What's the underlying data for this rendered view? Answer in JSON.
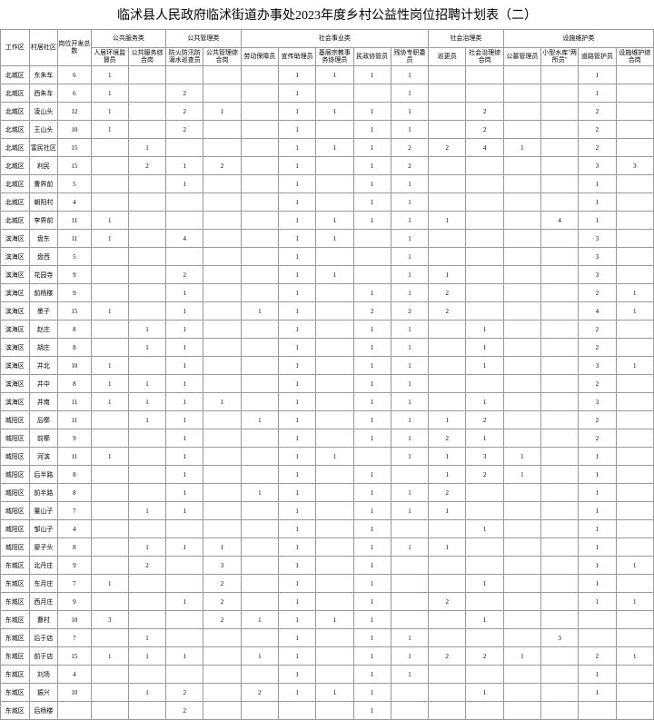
{
  "title": "临沭县人民政府临沭街道办事处2023年度乡村公益性岗位招聘计划表（二）",
  "headers": {
    "area": "工作区",
    "village": "村居社区",
    "total": "岗位开发总数",
    "g1": "公共服务类",
    "g2": "公共管理类",
    "g3": "社会事业类",
    "g4": "社会治理类",
    "g5": "设施维护类",
    "c1": "人居环境监督员",
    "c2": "公共服务综合岗",
    "c3": "防火防汛防溺水巡查员",
    "c4": "公共管理综合岗",
    "c5": "劳动保障员",
    "c6": "宣传助理员",
    "c7": "基层宗教事务协理员",
    "c8": "民政协管员",
    "c9": "残协专职委员",
    "c10": "巡更员",
    "c11": "社会治理综合岗",
    "c12": "公墓管理员",
    "c13": "小型水库\"两所员\"",
    "c14": "道路管护员",
    "c15": "设施维护综合岗"
  },
  "rows": [
    {
      "a": "北城区",
      "v": "东朱车",
      "t": "6",
      "d": [
        "1",
        "",
        "",
        "",
        "",
        "1",
        "1",
        "1",
        "1",
        "",
        "",
        "",
        "",
        "1",
        ""
      ]
    },
    {
      "a": "北城区",
      "v": "西朱车",
      "t": "6",
      "d": [
        "1",
        "",
        "2",
        "",
        "",
        "1",
        "",
        "",
        "1",
        "",
        "",
        "",
        "",
        "1",
        ""
      ]
    },
    {
      "a": "北城区",
      "v": "凌山头",
      "t": "12",
      "d": [
        "1",
        "",
        "2",
        "1",
        "",
        "1",
        "1",
        "1",
        "1",
        "",
        "2",
        "",
        "",
        "2",
        ""
      ]
    },
    {
      "a": "北城区",
      "v": "王山头",
      "t": "10",
      "d": [
        "1",
        "",
        "2",
        "",
        "",
        "1",
        "",
        "1",
        "1",
        "",
        "2",
        "",
        "",
        "2",
        ""
      ]
    },
    {
      "a": "北城区",
      "v": "富民社区",
      "t": "15",
      "d": [
        "",
        "1",
        "",
        "",
        "",
        "1",
        "1",
        "1",
        "2",
        "2",
        "4",
        "1",
        "",
        "2",
        ""
      ]
    },
    {
      "a": "北城区",
      "v": "利民",
      "t": "15",
      "d": [
        "",
        "2",
        "1",
        "2",
        "",
        "1",
        "",
        "1",
        "2",
        "",
        "",
        "",
        "",
        "3",
        "3"
      ]
    },
    {
      "a": "北城区",
      "v": "曹界前",
      "t": "5",
      "d": [
        "",
        "",
        "1",
        "",
        "",
        "1",
        "",
        "1",
        "1",
        "",
        "",
        "",
        "",
        "1",
        ""
      ]
    },
    {
      "a": "北城区",
      "v": "朝阳村",
      "t": "4",
      "d": [
        "",
        "",
        "",
        "",
        "",
        "1",
        "",
        "1",
        "1",
        "",
        "",
        "",
        "",
        "1",
        ""
      ]
    },
    {
      "a": "北城区",
      "v": "李界前",
      "t": "11",
      "d": [
        "1",
        "",
        "",
        "",
        "",
        "1",
        "1",
        "1",
        "1",
        "1",
        "",
        "",
        "4",
        "1",
        ""
      ]
    },
    {
      "a": "滨海区",
      "v": "盘东",
      "t": "11",
      "d": [
        "1",
        "",
        "4",
        "",
        "",
        "1",
        "1",
        "",
        "1",
        "",
        "",
        "",
        "",
        "3",
        ""
      ]
    },
    {
      "a": "滨海区",
      "v": "盘西",
      "t": "5",
      "d": [
        "",
        "",
        "",
        "",
        "",
        "1",
        "",
        "",
        "1",
        "",
        "",
        "",
        "",
        "3",
        ""
      ]
    },
    {
      "a": "滨海区",
      "v": "花园寺",
      "t": "9",
      "d": [
        "",
        "",
        "2",
        "",
        "",
        "1",
        "1",
        "",
        "1",
        "1",
        "",
        "",
        "",
        "3",
        ""
      ]
    },
    {
      "a": "滨海区",
      "v": "前杨楼",
      "t": "9",
      "d": [
        "",
        "",
        "1",
        "",
        "",
        "1",
        "",
        "1",
        "1",
        "2",
        "",
        "",
        "",
        "2",
        "1"
      ]
    },
    {
      "a": "滨海区",
      "v": "墨子",
      "t": "15",
      "d": [
        "1",
        "",
        "1",
        "",
        "1",
        "1",
        "",
        "2",
        "2",
        "2",
        "",
        "",
        "",
        "4",
        "1"
      ]
    },
    {
      "a": "滨海区",
      "v": "赵庄",
      "t": "8",
      "d": [
        "",
        "1",
        "1",
        "",
        "",
        "1",
        "",
        "1",
        "1",
        "",
        "1",
        "",
        "",
        "2",
        ""
      ]
    },
    {
      "a": "滨海区",
      "v": "胡庄",
      "t": "8",
      "d": [
        "",
        "1",
        "1",
        "",
        "",
        "1",
        "",
        "1",
        "1",
        "",
        "1",
        "",
        "",
        "2",
        ""
      ]
    },
    {
      "a": "滨海区",
      "v": "井北",
      "t": "10",
      "d": [
        "1",
        "",
        "1",
        "",
        "",
        "1",
        "",
        "1",
        "1",
        "",
        "1",
        "",
        "",
        "3",
        "1"
      ]
    },
    {
      "a": "滨海区",
      "v": "井中",
      "t": "8",
      "d": [
        "1",
        "1",
        "1",
        "",
        "",
        "1",
        "",
        "1",
        "1",
        "",
        "",
        "",
        "",
        "2",
        ""
      ]
    },
    {
      "a": "滨海区",
      "v": "井南",
      "t": "11",
      "d": [
        "1",
        "1",
        "1",
        "1",
        "",
        "1",
        "",
        "1",
        "1",
        "",
        "1",
        "",
        "",
        "3",
        ""
      ]
    },
    {
      "a": "城阳区",
      "v": "后槨",
      "t": "11",
      "d": [
        "",
        "1",
        "1",
        "",
        "1",
        "1",
        "",
        "1",
        "1",
        "1",
        "2",
        "",
        "",
        "2",
        ""
      ]
    },
    {
      "a": "城阳区",
      "v": "前槨",
      "t": "9",
      "d": [
        "",
        "",
        "1",
        "",
        "",
        "1",
        "",
        "1",
        "1",
        "2",
        "1",
        "",
        "",
        "2",
        ""
      ]
    },
    {
      "a": "城阳区",
      "v": "河滨",
      "t": "11",
      "d": [
        "1",
        "",
        "1",
        "",
        "",
        "1",
        "1",
        "",
        "1",
        "1",
        "3",
        "1",
        "",
        "1",
        ""
      ]
    },
    {
      "a": "城阳区",
      "v": "后半路",
      "t": "8",
      "d": [
        "",
        "",
        "1",
        "",
        "",
        "1",
        "",
        "1",
        "",
        "1",
        "2",
        "1",
        "",
        "1",
        ""
      ]
    },
    {
      "a": "城阳区",
      "v": "前半路",
      "t": "8",
      "d": [
        "",
        "",
        "1",
        "",
        "1",
        "1",
        "",
        "1",
        "1",
        "2",
        "",
        "",
        "",
        "1",
        ""
      ]
    },
    {
      "a": "城阳区",
      "v": "董山子",
      "t": "7",
      "d": [
        "",
        "1",
        "1",
        "",
        "",
        "1",
        "",
        "1",
        "1",
        "1",
        "",
        "",
        "",
        "1",
        ""
      ]
    },
    {
      "a": "城阳区",
      "v": "邹山子",
      "t": "4",
      "d": [
        "",
        "",
        "",
        "",
        "",
        "1",
        "",
        "1",
        "",
        "",
        "1",
        "",
        "",
        "1",
        ""
      ]
    },
    {
      "a": "城阳区",
      "v": "廖子头",
      "t": "8",
      "d": [
        "",
        "1",
        "1",
        "1",
        "",
        "1",
        "",
        "1",
        "1",
        "1",
        "",
        "",
        "",
        "1",
        ""
      ]
    },
    {
      "a": "东城区",
      "v": "北丹庄",
      "t": "9",
      "d": [
        "",
        "2",
        "",
        "3",
        "",
        "1",
        "",
        "1",
        "",
        "",
        "",
        "",
        "",
        "1",
        "1"
      ]
    },
    {
      "a": "东城区",
      "v": "东月庄",
      "t": "7",
      "d": [
        "1",
        "",
        "",
        "2",
        "",
        "1",
        "",
        "1",
        "",
        "",
        "1",
        "",
        "",
        "1",
        ""
      ]
    },
    {
      "a": "东城区",
      "v": "西月庄",
      "t": "9",
      "d": [
        "",
        "",
        "1",
        "2",
        "",
        "1",
        "",
        "1",
        "",
        "2",
        "",
        "",
        "",
        "1",
        "1"
      ]
    },
    {
      "a": "东城区",
      "v": "曹村",
      "t": "10",
      "d": [
        "3",
        "",
        "",
        "2",
        "1",
        "1",
        "1",
        "1",
        "",
        "",
        "1",
        "",
        "",
        "",
        ""
      ]
    },
    {
      "a": "东城区",
      "v": "后于店",
      "t": "7",
      "d": [
        "",
        "1",
        "",
        "",
        "",
        "1",
        "",
        "1",
        "1",
        "",
        "",
        "",
        "3",
        "",
        ""
      ]
    },
    {
      "a": "东城区",
      "v": "前于店",
      "t": "15",
      "d": [
        "1",
        "1",
        "1",
        "",
        "1",
        "1",
        "",
        "1",
        "1",
        "2",
        "2",
        "1",
        "",
        "2",
        "1"
      ]
    },
    {
      "a": "东城区",
      "v": "刘场",
      "t": "4",
      "d": [
        "",
        "",
        "",
        "",
        "",
        "1",
        "",
        "1",
        "1",
        "",
        "",
        "",
        "",
        "1",
        ""
      ]
    },
    {
      "a": "东城区",
      "v": "振兴",
      "t": "10",
      "d": [
        "",
        "1",
        "2",
        "",
        "2",
        "1",
        "1",
        "1",
        "",
        "",
        "1",
        "",
        "",
        "1",
        ""
      ]
    },
    {
      "a": "东城区",
      "v": "后杨楼",
      "t": "",
      "d": [
        "",
        "",
        "2",
        "",
        "",
        "",
        "",
        "1",
        "",
        "",
        "",
        "",
        "",
        "",
        ""
      ]
    }
  ]
}
